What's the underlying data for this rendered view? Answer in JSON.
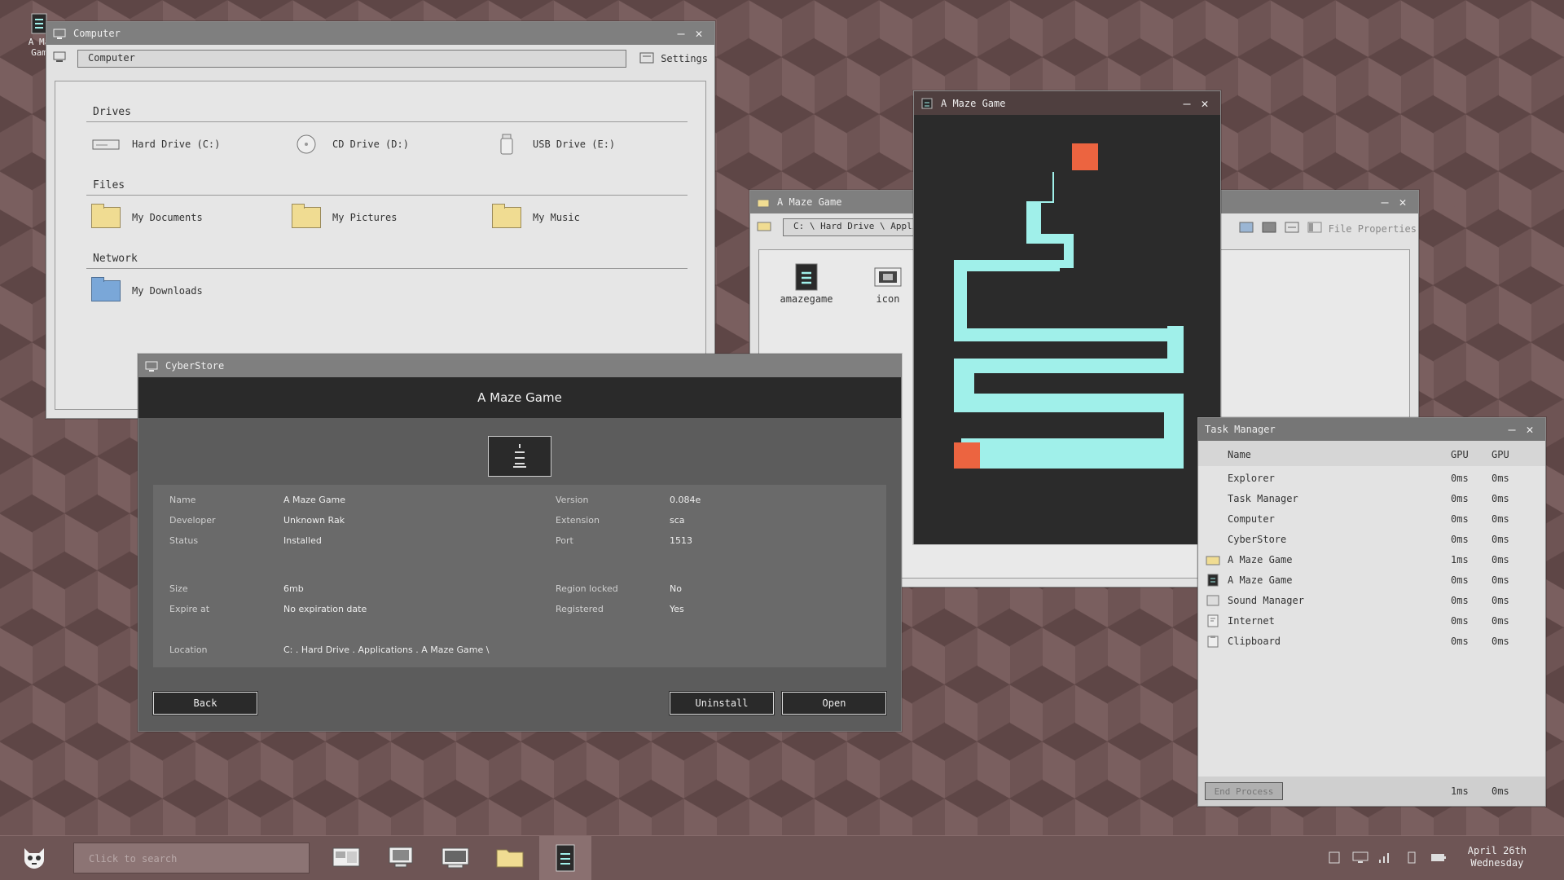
{
  "desktop": {
    "icon_label_line1": "A Ma",
    "icon_label_line2": "Gam"
  },
  "computer_window": {
    "title": "Computer",
    "address": "Computer",
    "settings_label": "Settings",
    "sections": [
      {
        "heading": "Drives",
        "items": [
          "Hard Drive (C:)",
          "CD Drive (D:)",
          "USB Drive (E:)"
        ]
      },
      {
        "heading": "Files",
        "items": [
          "My Documents",
          "My Pictures",
          "My Music"
        ]
      },
      {
        "heading": "Network",
        "items": [
          "My Downloads"
        ]
      }
    ]
  },
  "store_window": {
    "title": "CyberStore",
    "header": "A Maze Game",
    "props": {
      "name_label": "Name",
      "name": "A Maze Game",
      "developer_label": "Developer",
      "developer": "Unknown Rak",
      "status_label": "Status",
      "status": "Installed",
      "version_label": "Version",
      "version": "0.084e",
      "extension_label": "Extension",
      "extension": "sca",
      "port_label": "Port",
      "port": "1513",
      "size_label": "Size",
      "size": "6mb",
      "expire_label": "Expire at",
      "expire": "No expiration date",
      "region_label": "Region locked",
      "region": "No",
      "registered_label": "Registered",
      "registered": "Yes",
      "location_label": "Location",
      "location": "C: . Hard Drive . Applications . A Maze Game \\"
    },
    "buttons": {
      "back": "Back",
      "uninstall": "Uninstall",
      "open": "Open"
    }
  },
  "explorer_window": {
    "title": "A Maze Game",
    "address": "C: \\ Hard Drive \\ Applic",
    "file_properties": "File Properties",
    "files": [
      "amazegame",
      "icon"
    ]
  },
  "game_window": {
    "title": "A Maze Game",
    "colors": {
      "background": "#2b2b2b",
      "path": "#a0f0ea",
      "marker": "#ec6440"
    }
  },
  "task_manager": {
    "title": "Task Manager",
    "columns": [
      "Name",
      "GPU",
      "GPU"
    ],
    "rows": [
      {
        "name": "Explorer",
        "c1": "0ms",
        "c2": "0ms"
      },
      {
        "name": "Task Manager",
        "c1": "0ms",
        "c2": "0ms"
      },
      {
        "name": "Computer",
        "c1": "0ms",
        "c2": "0ms"
      },
      {
        "name": "CyberStore",
        "c1": "0ms",
        "c2": "0ms"
      },
      {
        "name": "A Maze Game",
        "c1": "1ms",
        "c2": "0ms"
      },
      {
        "name": "A Maze Game",
        "c1": "0ms",
        "c2": "0ms"
      },
      {
        "name": "Sound Manager",
        "c1": "0ms",
        "c2": "0ms"
      },
      {
        "name": "Internet",
        "c1": "0ms",
        "c2": "0ms"
      },
      {
        "name": "Clipboard",
        "c1": "0ms",
        "c2": "0ms"
      }
    ],
    "end_process": "End Process",
    "total_c1": "1ms",
    "total_c2": "0ms"
  },
  "taskbar": {
    "search_placeholder": "Click to search",
    "date": "April 26th",
    "weekday": "Wednesday"
  }
}
